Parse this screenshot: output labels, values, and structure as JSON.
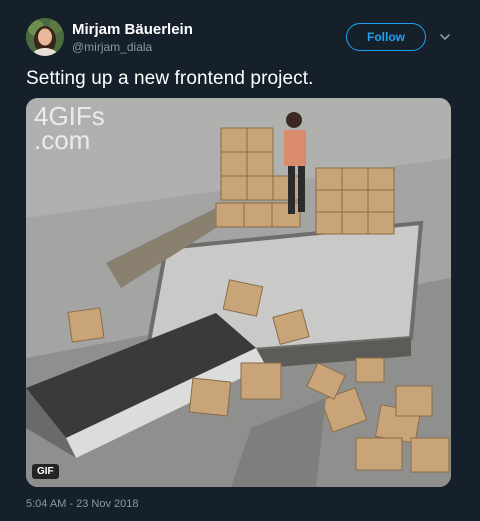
{
  "user": {
    "name": "Mirjam Bäuerlein",
    "handle": "@mirjam_diala",
    "follow_label": "Follow"
  },
  "tweet": {
    "text": "Setting up a new frontend project.",
    "timestamp": "5:04 AM - 23 Nov 2018"
  },
  "media": {
    "watermark_line1": "4GIFs",
    "watermark_line2": ".com",
    "badge": "GIF"
  },
  "icons": {
    "more": "chevron-down-icon"
  },
  "colors": {
    "background": "#15202b",
    "accent": "#1da1f2",
    "secondary_text": "#8899a6"
  }
}
